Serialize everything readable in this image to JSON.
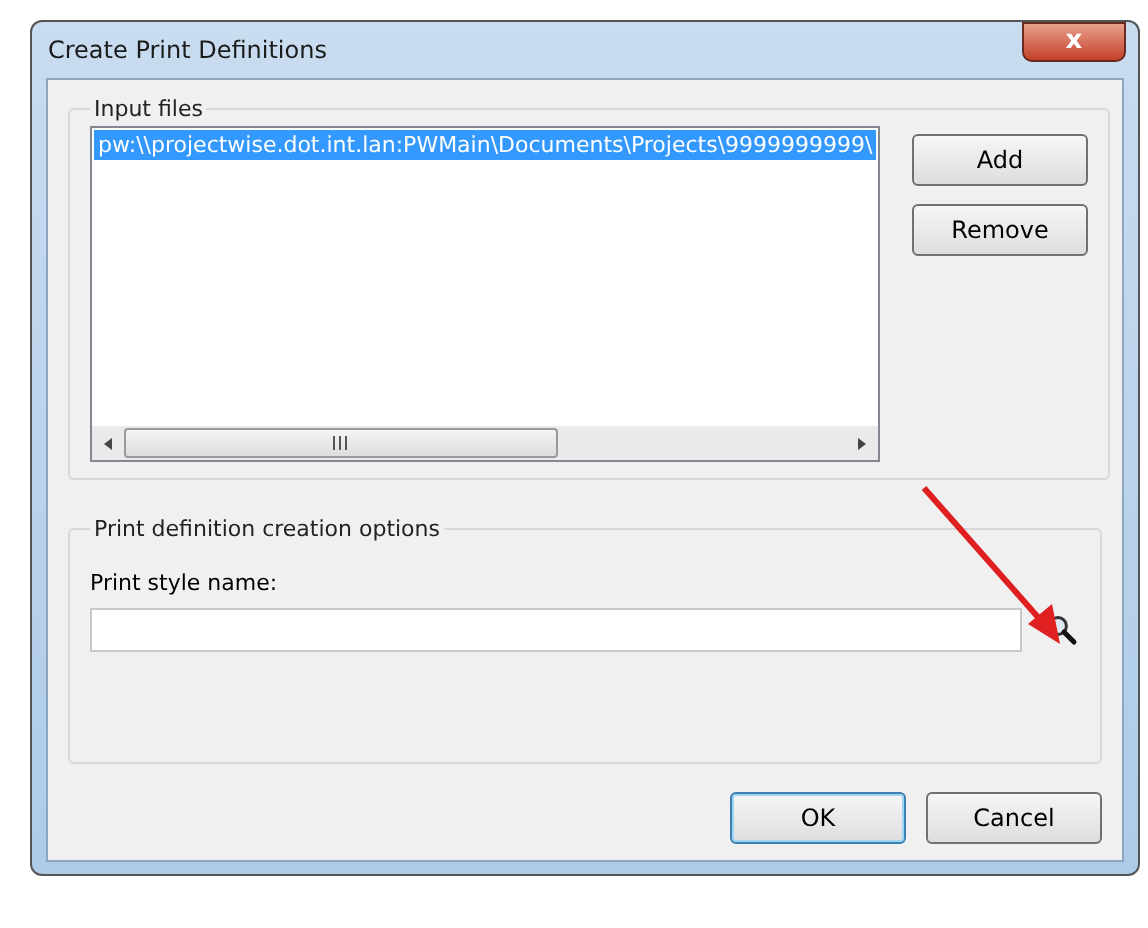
{
  "window": {
    "title": "Create Print Definitions",
    "close_label": "x"
  },
  "input_files": {
    "label": "Input files",
    "items": [
      {
        "path": "pw:\\\\projectwise.dot.int.lan:PWMain\\Documents\\Projects\\9999999999\\",
        "selected": true
      }
    ],
    "buttons": [
      "Add",
      "Remove"
    ]
  },
  "options": {
    "label": "Print definition creation options",
    "field_label": "Print style name:"
  },
  "buttons": [
    {
      "label": "OK",
      "default": true
    },
    {
      "label": "Cancel",
      "default": false
    }
  ]
}
